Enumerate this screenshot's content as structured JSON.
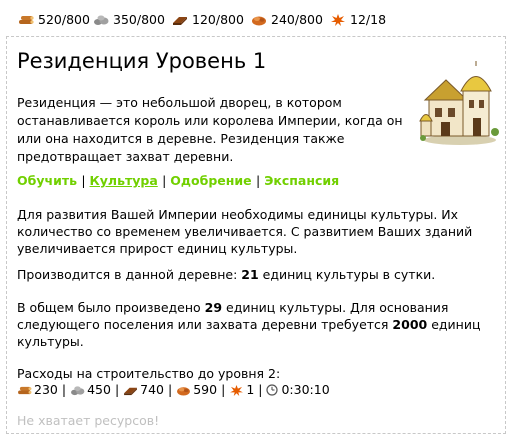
{
  "resources": {
    "wood": "520/800",
    "clay": "350/800",
    "iron": "120/800",
    "crop": "240/800",
    "crop_consumption": "12/18"
  },
  "page": {
    "title": "Резиденция Уровень 1",
    "description": "Резиденция — это небольшой дворец, в котором останавливается король или королева Империи, когда он или она находится в деревне. Резиденция также предотвращает захват деревни."
  },
  "tabs": [
    {
      "label": "Обучить"
    },
    {
      "label": "Культура",
      "active": true
    },
    {
      "label": "Одобрение"
    },
    {
      "label": "Экспансия"
    }
  ],
  "tab_separator": "|",
  "culture": {
    "info": "Для развития Вашей Империи необходимы единицы культуры. Их количество со временем увеличивается. С развитием Ваших зданий увеличивается прирост единиц культуры.",
    "prod_prefix": "Производится в данной деревне: ",
    "prod_value": "21",
    "prod_suffix": " единиц культуры в сутки.",
    "total_prefix": "В общем было произведено ",
    "total_value": "29",
    "total_middle": " единиц культуры. Для основания следующего поселения или захвата деревни требуется ",
    "total_required": "2000",
    "total_suffix": " единиц культуры."
  },
  "costs": {
    "label": "Расходы на строительство до уровня 2:",
    "wood": "230",
    "clay": "450",
    "iron": "740",
    "crop": "590",
    "crop_consumption": "1",
    "time": "0:30:10",
    "separator": "|"
  },
  "warning": "Не хватает ресурсов!",
  "colors": {
    "tab_link": "#71d000",
    "warning": "#c0c0c0",
    "border": "#c8c8c8"
  },
  "icons": {
    "wood": "wood-icon",
    "clay": "clay-icon",
    "iron": "iron-icon",
    "crop": "crop-icon",
    "crop_consumption": "crop-consumption-icon",
    "time": "clock-icon"
  }
}
